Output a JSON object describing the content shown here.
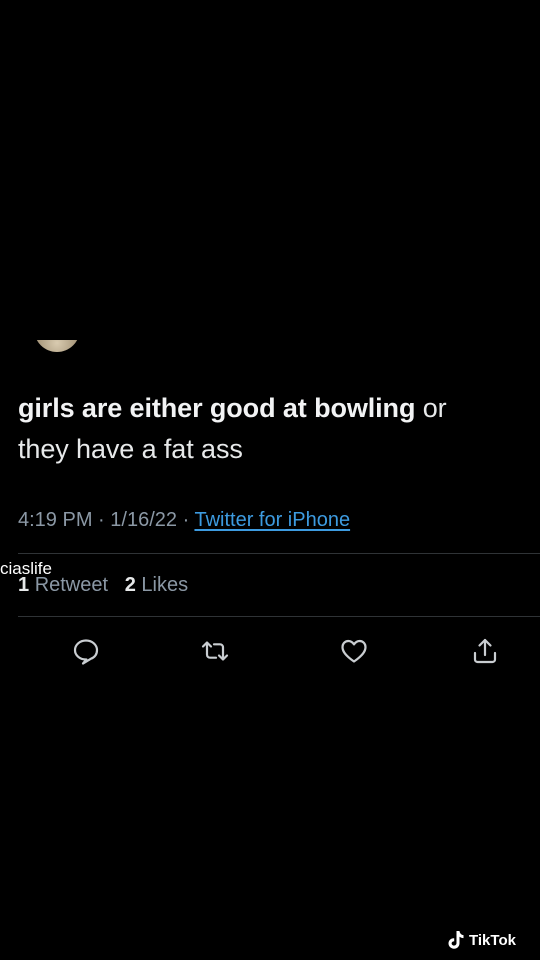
{
  "tweet": {
    "text_bold": "girls are either good at bowling",
    "text_rest_line1": " or",
    "text_line2": "they have a fat ass",
    "time": "4:19 PM",
    "separator": "·",
    "date": "1/16/22",
    "source": "Twitter for iPhone"
  },
  "stats": {
    "retweets_count": "1",
    "retweets_label": "Retweet",
    "likes_count": "2",
    "likes_label": "Likes"
  },
  "overlay": {
    "username": "ciaslife",
    "platform": "TikTok"
  },
  "actions": [
    {
      "name": "reply",
      "icon": "speech-bubble-icon"
    },
    {
      "name": "retweet",
      "icon": "retweet-arrows-icon"
    },
    {
      "name": "like",
      "icon": "heart-icon"
    },
    {
      "name": "share",
      "icon": "share-upload-icon"
    }
  ],
  "colors": {
    "background": "#000000",
    "text": "#e7e9ea",
    "muted": "#8b98a5",
    "link": "#3d9be0",
    "divider": "#2f3336"
  }
}
